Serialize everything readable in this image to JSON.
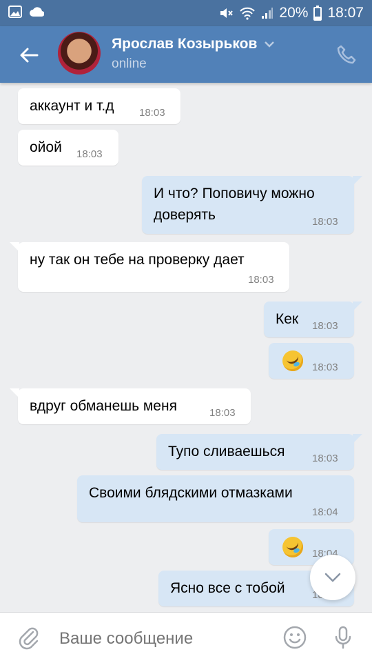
{
  "status_bar": {
    "battery": "20%",
    "time": "18:07",
    "icons": [
      "gallery-icon",
      "cloud-icon",
      "mute-icon",
      "wifi-icon",
      "signal-icon",
      "battery-icon"
    ]
  },
  "header": {
    "name": "Ярослав Козырьков",
    "status": "online",
    "icons": [
      "back-arrow-icon",
      "chevron-down-icon",
      "phone-icon"
    ]
  },
  "messages": [
    {
      "dir": "in",
      "text": "аккаунт и т.д",
      "time": "18:03"
    },
    {
      "dir": "in",
      "text": "ойой",
      "time": "18:03"
    },
    {
      "dir": "out",
      "text_line1": "И что? Поповичу можно",
      "text_line2": "доверять",
      "time": "18:03"
    },
    {
      "dir": "in",
      "text": "ну так он тебе на проверку дает",
      "time": "18:03"
    },
    {
      "dir": "out",
      "text": "Кек",
      "time": "18:03"
    },
    {
      "dir": "out",
      "emoji": "rofl-emoji",
      "time": "18:03"
    },
    {
      "dir": "in",
      "text": "вдруг обманешь меня",
      "time": "18:03"
    },
    {
      "dir": "out",
      "text": "Тупо сливаешься",
      "time": "18:03"
    },
    {
      "dir": "out",
      "text": "Своими блядскими отмазками",
      "time": "18:04"
    },
    {
      "dir": "out",
      "emoji": "rofl-emoji",
      "time": "18:04"
    },
    {
      "dir": "out",
      "text": "Ясно все с тобой",
      "time": "18:04"
    }
  ],
  "composer": {
    "placeholder": "Ваше сообщение",
    "icons": [
      "attach-icon",
      "smile-icon",
      "microphone-icon"
    ]
  },
  "colors": {
    "header": "#5181b8",
    "status_bar": "#4a72a0",
    "background": "#edeef0",
    "incoming_bubble": "#ffffff",
    "outgoing_bubble": "#d7e6f5",
    "time_text": "#828282"
  }
}
